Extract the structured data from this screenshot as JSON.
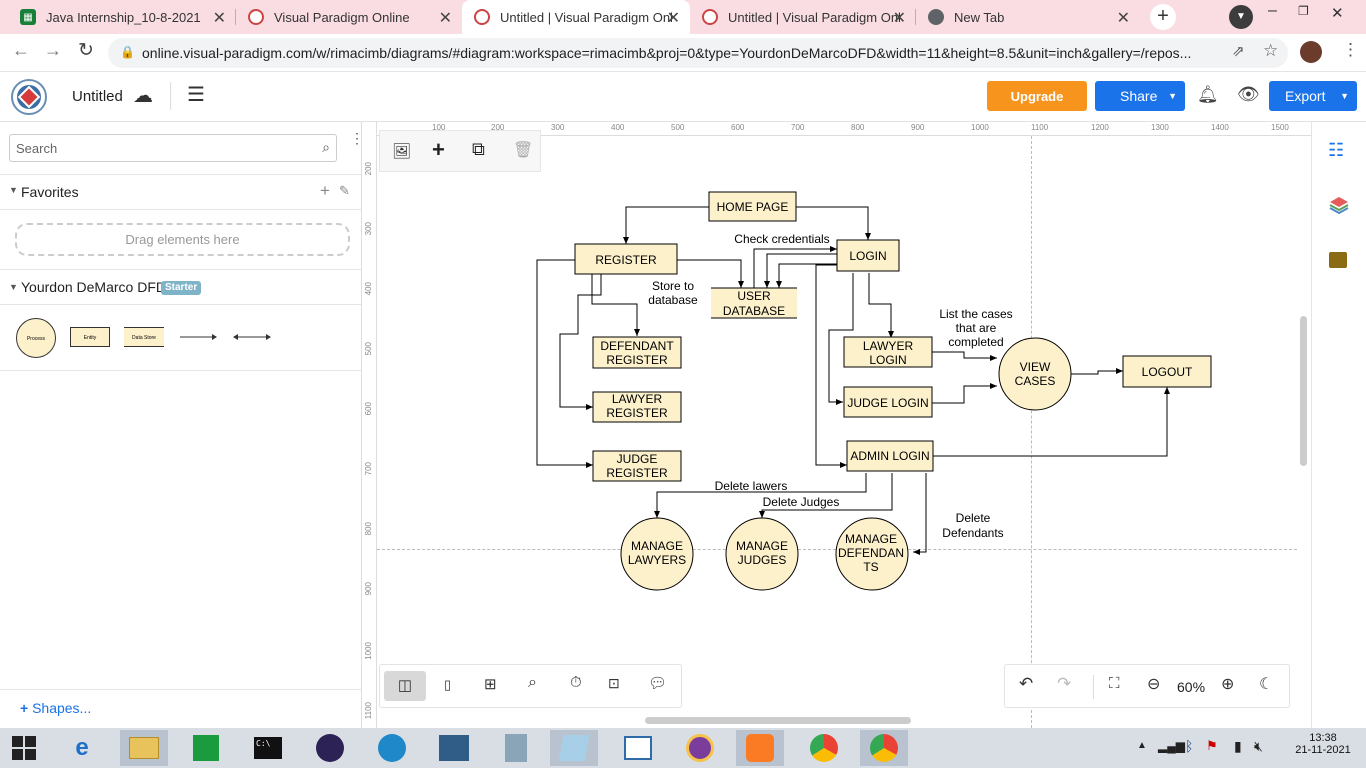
{
  "browser": {
    "tabs": [
      {
        "title": "Java Internship_10-8-2021",
        "favicon": "sheets-icon"
      },
      {
        "title": "Visual Paradigm Online",
        "favicon": "vp-icon"
      },
      {
        "title": "Untitled | Visual Paradigm Onl",
        "favicon": "vp-icon"
      },
      {
        "title": "Untitled | Visual Paradigm Onl",
        "favicon": "vp-icon"
      },
      {
        "title": "New Tab",
        "favicon": "chrome-icon"
      }
    ],
    "url": "online.visual-paradigm.com/w/rimacimb/diagrams/#diagram:workspace=rimacimb&proj=0&type=YourdonDeMarcoDFD&width=11&height=8.5&unit=inch&gallery=/repos..."
  },
  "app": {
    "doc_title": "Untitled",
    "upgrade": "Upgrade",
    "share": "Share",
    "export": "Export",
    "accent": "#1a73e8",
    "upgrade_color": "#f7941d"
  },
  "sidebar": {
    "search_placeholder": "Search",
    "favorites": "Favorites",
    "drag_hint": "Drag elements here",
    "group_title": "Yourdon DeMarco DFD",
    "badge": "Starter",
    "shapes_link": "Shapes...",
    "shape_labels": [
      "Process",
      "Entity",
      "Data Store"
    ]
  },
  "rulers": {
    "top": [
      "100",
      "200",
      "300",
      "400",
      "500",
      "600",
      "700",
      "800",
      "900",
      "1000",
      "1100",
      "1200",
      "1300",
      "1400",
      "1500"
    ],
    "left": [
      "200",
      "300",
      "400",
      "500",
      "600",
      "700",
      "800",
      "900",
      "1000",
      "1100"
    ]
  },
  "diagram": {
    "entities": {
      "home": "HOME PAGE",
      "register": "REGISTER",
      "login": "LOGIN",
      "def_reg_1": "DEFENDANT",
      "def_reg_2": "REGISTER",
      "law_reg_1": "LAWYER",
      "law_reg_2": "REGISTER",
      "judge_reg_1": "JUDGE",
      "judge_reg_2": "REGISTER",
      "law_login_1": "LAWYER",
      "law_login_2": "LOGIN",
      "judge_login": "JUDGE LOGIN",
      "admin_login": "ADMIN LOGIN",
      "logout": "LOGOUT"
    },
    "store": {
      "line1": "USER",
      "line2": "DATABASE"
    },
    "processes": {
      "view_1": "VIEW",
      "view_2": "CASES",
      "mlaw_1": "MANAGE",
      "mlaw_2": "LAWYERS",
      "mjudge_1": "MANAGE",
      "mjudge_2": "JUDGES",
      "mdef_1": "MANAGE",
      "mdef_2": "DEFENDAN",
      "mdef_3": "TS"
    },
    "labels": {
      "check": "Check credentials",
      "store_1": "Store to",
      "store_2": "database",
      "list_1": "List the cases",
      "list_2": "that are",
      "list_3": "completed",
      "del_lawers": "Delete lawers",
      "del_judges": "Delete Judges",
      "del_def_1": "Delete",
      "del_def_2": "Defendants"
    },
    "fill": "#fdf1cc"
  },
  "zoom": "60%",
  "clock": {
    "time": "13:38",
    "date": "21-11-2021"
  }
}
